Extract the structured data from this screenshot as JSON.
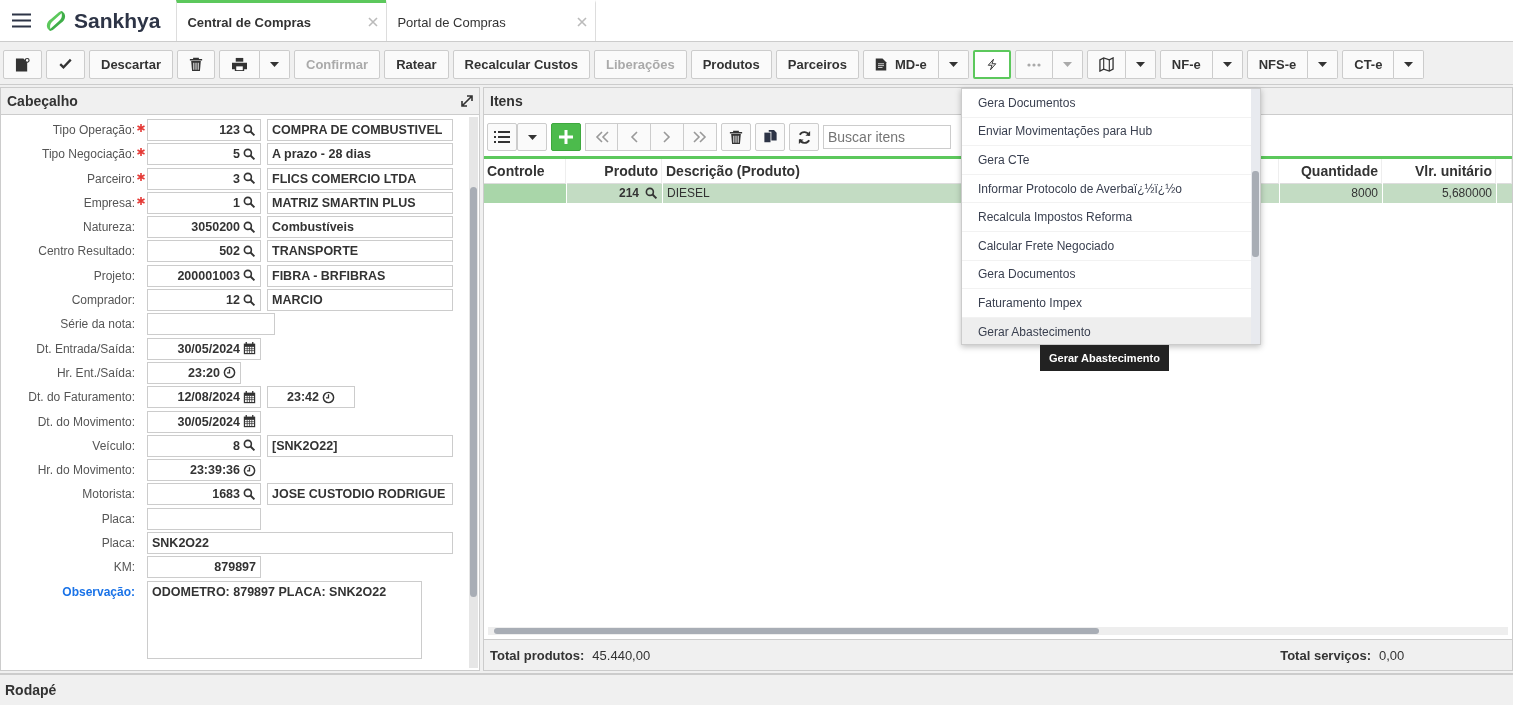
{
  "app": {
    "brand": "Sankhya"
  },
  "tabs": [
    {
      "label": "Central de Compras",
      "selected": true
    },
    {
      "label": "Portal de Compras",
      "selected": false
    }
  ],
  "toolbar": [
    {
      "kind": "new",
      "expanded": false
    },
    {
      "kind": "confirm",
      "expanded": false
    },
    {
      "kind": "text",
      "label": "Descartar",
      "disabled": false,
      "expanded": false
    },
    {
      "kind": "trash",
      "expanded": false
    },
    {
      "kind": "print",
      "expanded": false
    },
    {
      "kind": "text",
      "label": "Confirmar",
      "disabled": true,
      "expanded": false
    },
    {
      "kind": "text",
      "label": "Ratear",
      "disabled": false,
      "expanded": false
    },
    {
      "kind": "text",
      "label": "Recalcular Custos",
      "disabled": false,
      "expanded": false
    },
    {
      "kind": "text",
      "label": "Liberações",
      "disabled": true,
      "expanded": false
    },
    {
      "kind": "text",
      "label": "Produtos",
      "disabled": false,
      "expanded": false
    },
    {
      "kind": "text",
      "label": "Parceiros",
      "disabled": false,
      "expanded": false
    },
    {
      "kind": "document",
      "label": "MD-e",
      "disabled": false,
      "expanded": false
    },
    {
      "kind": "action",
      "expanded": true
    },
    {
      "kind": "more",
      "disabled": true,
      "expanded": false
    },
    {
      "kind": "map",
      "expanded": false
    },
    {
      "kind": "split",
      "label": "NF-e",
      "disabled": false,
      "expanded": false
    },
    {
      "kind": "split",
      "label": "NFS-e",
      "disabled": false,
      "expanded": false
    },
    {
      "kind": "split",
      "label": "CT-e",
      "disabled": false,
      "expanded": false
    }
  ],
  "header_panel": {
    "title": "Cabeçalho",
    "fields": [
      {
        "kind": "lookup",
        "label": "Tipo Operação:",
        "required": true,
        "link": false,
        "code": "123",
        "description": "COMPRA DE COMBUSTIVEL"
      },
      {
        "kind": "lookup",
        "label": "Tipo Negociação:",
        "required": true,
        "link": false,
        "code": "5",
        "description": "A prazo - 28 dias"
      },
      {
        "kind": "lookup",
        "label": "Parceiro:",
        "required": true,
        "link": false,
        "code": "3",
        "description": "FLICS COMERCIO LTDA"
      },
      {
        "kind": "lookup",
        "label": "Empresa:",
        "required": true,
        "link": false,
        "code": "1",
        "description": "MATRIZ SMARTIN PLUS"
      },
      {
        "kind": "lookup",
        "label": "Natureza:",
        "required": false,
        "link": false,
        "code": "3050200",
        "description": "Combustíveis"
      },
      {
        "kind": "lookup",
        "label": "Centro Resultado:",
        "required": false,
        "link": false,
        "code": "502",
        "description": "TRANSPORTE"
      },
      {
        "kind": "lookup",
        "label": "Projeto:",
        "required": false,
        "link": false,
        "code": "200001003",
        "description": "FIBRA - BRFIBRAS"
      },
      {
        "kind": "lookup",
        "label": "Comprador:",
        "required": false,
        "link": false,
        "code": "12",
        "description": "MARCIO"
      },
      {
        "kind": "entry",
        "label": "Série da nota:",
        "required": false,
        "link": false
      },
      {
        "kind": "date",
        "label": "Dt. Entrada/Saída:",
        "required": false,
        "link": false,
        "value": "30/05/2024"
      },
      {
        "kind": "time",
        "label": "Hr. Ent./Saída:",
        "required": false,
        "link": false,
        "value": "23:20"
      },
      {
        "kind": "datetime",
        "label": "Dt. do Faturamento:",
        "required": false,
        "link": false,
        "value": "12/08/2024",
        "time": "23:42"
      },
      {
        "kind": "date",
        "label": "Dt. do Movimento:",
        "required": false,
        "link": false,
        "value": "30/05/2024"
      },
      {
        "kind": "lookup",
        "label": "Veículo:",
        "required": false,
        "link": false,
        "code": "8",
        "description": "[SNK2O22]"
      },
      {
        "kind": "clock",
        "label": "Hr. do Movimento:",
        "required": false,
        "link": false,
        "value": "23:39:36"
      },
      {
        "kind": "lookup",
        "label": "Motorista:",
        "required": false,
        "link": false,
        "code": "1683",
        "description": "JOSE CUSTODIO RODRIGUE"
      },
      {
        "kind": "text",
        "label": "Placa:",
        "required": false,
        "link": false
      },
      {
        "kind": "wide",
        "label": "Placa:",
        "required": false,
        "link": false,
        "value": "SNK2O22"
      },
      {
        "kind": "text",
        "label": "KM:",
        "required": false,
        "link": false,
        "value": "879897"
      },
      {
        "kind": "memo",
        "label": "Observação:",
        "required": false,
        "link": true,
        "value": "ODOMETRO: 879897 PLACA: SNK2O22"
      }
    ]
  },
  "items_panel": {
    "title": "Itens",
    "search": {
      "placeholder": "Buscar itens"
    },
    "table": {
      "columns": [
        "Controle",
        "Produto",
        "Descrição (Produto)",
        "Quantidade",
        "Vlr. unitário"
      ],
      "rows": [
        {
          "selected": true,
          "cells": [
            "",
            "214",
            "DIESEL",
            "8000",
            "5,680000"
          ]
        }
      ]
    },
    "totals": [
      {
        "label": "Total produtos:",
        "value": "45.440,00"
      },
      {
        "label": "Total serviços:",
        "value": "0,00"
      }
    ]
  },
  "action_menu": {
    "items": [
      {
        "label": "Gera Documentos",
        "selected": false
      },
      {
        "label": "Enviar Movimentações para Hub",
        "selected": false
      },
      {
        "label": "Gera CTe",
        "selected": false
      },
      {
        "label": "Informar Protocolo de Averbaï¿½ï¿½o",
        "selected": false
      },
      {
        "label": "Recalcula Impostos Reforma",
        "selected": false
      },
      {
        "label": "Calcular Frete Negociado",
        "selected": false
      },
      {
        "label": "Gera Documentos",
        "selected": false
      },
      {
        "label": "Faturamento Impex",
        "selected": false
      },
      {
        "label": "Gerar Abastecimento",
        "selected": true
      }
    ],
    "tooltip": "Gerar Abastecimento"
  },
  "footer_panel": {
    "title": "Rodapé"
  }
}
